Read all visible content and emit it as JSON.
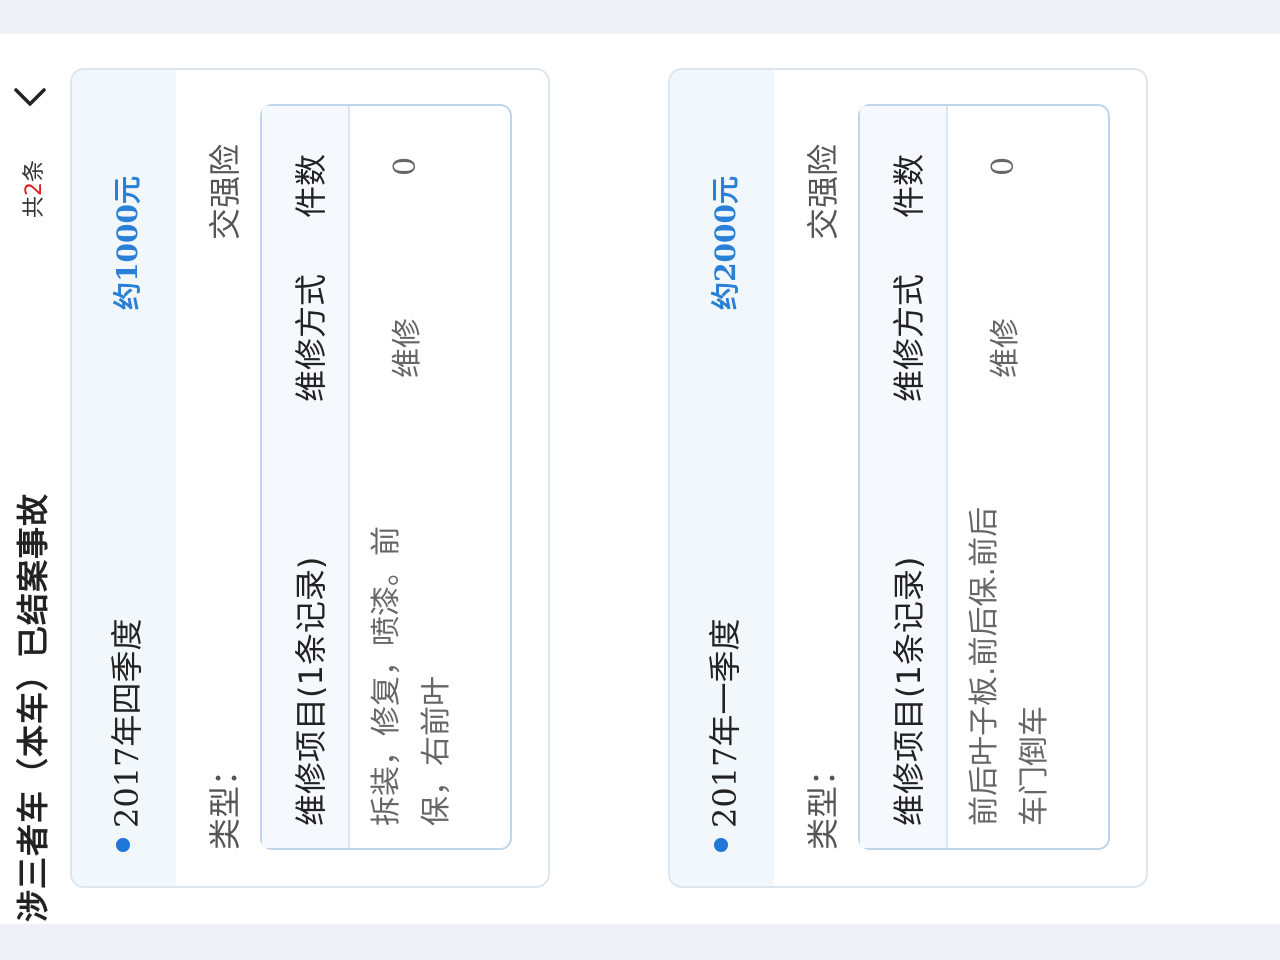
{
  "header": {
    "title": "涉三者车（本车）已结案事故",
    "count_prefix": "共",
    "count_num": "2",
    "count_suffix": "条",
    "back_icon": "chevron-left-icon"
  },
  "cards": [
    {
      "quarter": "2017年四季度",
      "amount": "约1000元",
      "type_label": "类型：",
      "type_value": "交强险",
      "table": {
        "col_item": "维修项目(1条记录)",
        "col_method": "维修方式",
        "col_count": "件数",
        "row": {
          "item": "拆装，修复，喷漆。前保，右前叶",
          "method": "维修",
          "count": "0"
        }
      }
    },
    {
      "quarter": "2017年一季度",
      "amount": "约2000元",
      "type_label": "类型：",
      "type_value": "交强险",
      "table": {
        "col_item": "维修项目(1条记录)",
        "col_method": "维修方式",
        "col_count": "件数",
        "row": {
          "item": "前后叶子板.前后保.前后车门倒车",
          "method": "维修",
          "count": "0"
        }
      }
    }
  ],
  "colors": {
    "accent": "#2a7fd6",
    "dot": "#1f77d8",
    "count_red": "#e02020"
  }
}
